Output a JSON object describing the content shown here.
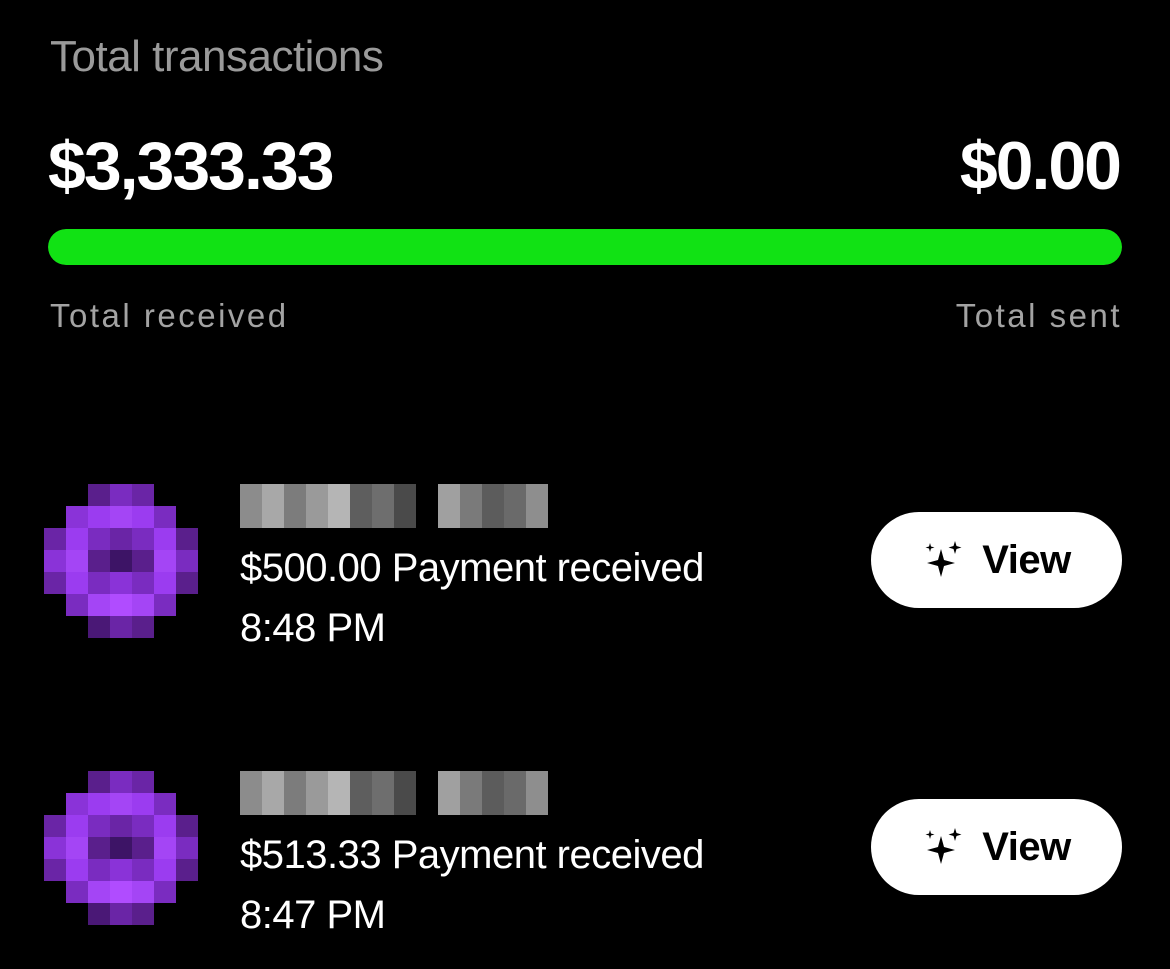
{
  "summary": {
    "title": "Total transactions",
    "received_amount": "$3,333.33",
    "sent_amount": "$0.00",
    "received_label": "Total received",
    "sent_label": "Total sent",
    "received_fraction": 1.0,
    "bar_color": "#11e214",
    "bar_track_color": "#2b2b2b"
  },
  "transactions": [
    {
      "description": "$500.00 Payment received",
      "time": "8:48 PM",
      "action_label": "View",
      "action_icon": "sparkles-icon",
      "avatar_color": "#9b3cf0"
    },
    {
      "description": "$513.33 Payment received",
      "time": "8:47 PM",
      "action_label": "View",
      "action_icon": "sparkles-icon",
      "avatar_color": "#9b3cf0"
    }
  ],
  "colors": {
    "background": "#000000",
    "primary_text": "#ffffff",
    "secondary_text": "#9a9a9a",
    "button_bg": "#ffffff",
    "button_text": "#000000"
  }
}
